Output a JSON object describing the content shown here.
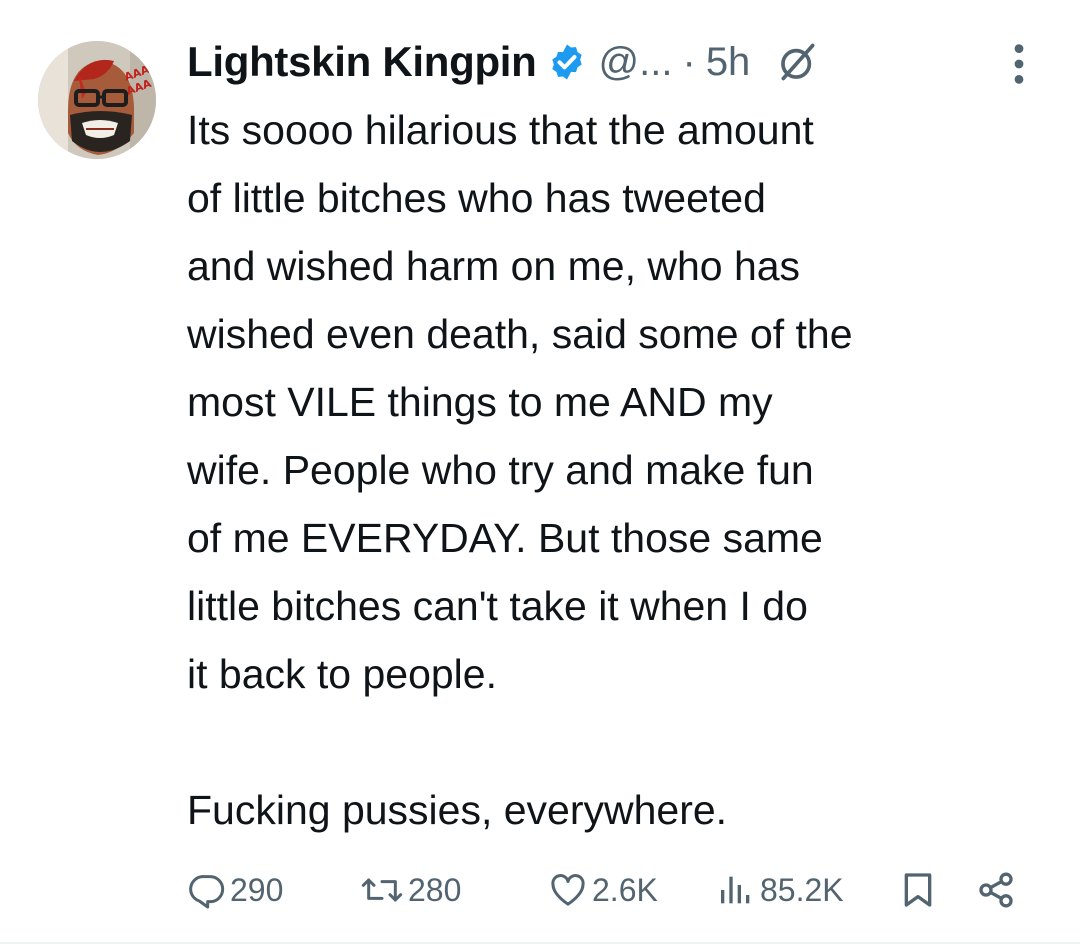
{
  "author": {
    "display_name": "Lightskin Kingpin",
    "handle": "@...",
    "separator": "·",
    "time": "5h",
    "verified": true,
    "avatar_icon": "avatar-image"
  },
  "tweet": {
    "text": "Its soooo hilarious that the amount\nof little bitches who has tweeted\nand wished harm on me, who has\nwished even death, said some of the\nmost VILE things to me AND my\nwife. People who try and make fun\nof me EVERYDAY. But those same\nlittle bitches can't take it when I do\nit back to people.\n\nFucking pussies, everywhere."
  },
  "actions": {
    "replies": "290",
    "reposts": "280",
    "likes": "2.6K",
    "views": "85.2K"
  },
  "colors": {
    "text": "#0f1419",
    "secondary": "#536471",
    "verified_blue": "#1d9bf0"
  }
}
